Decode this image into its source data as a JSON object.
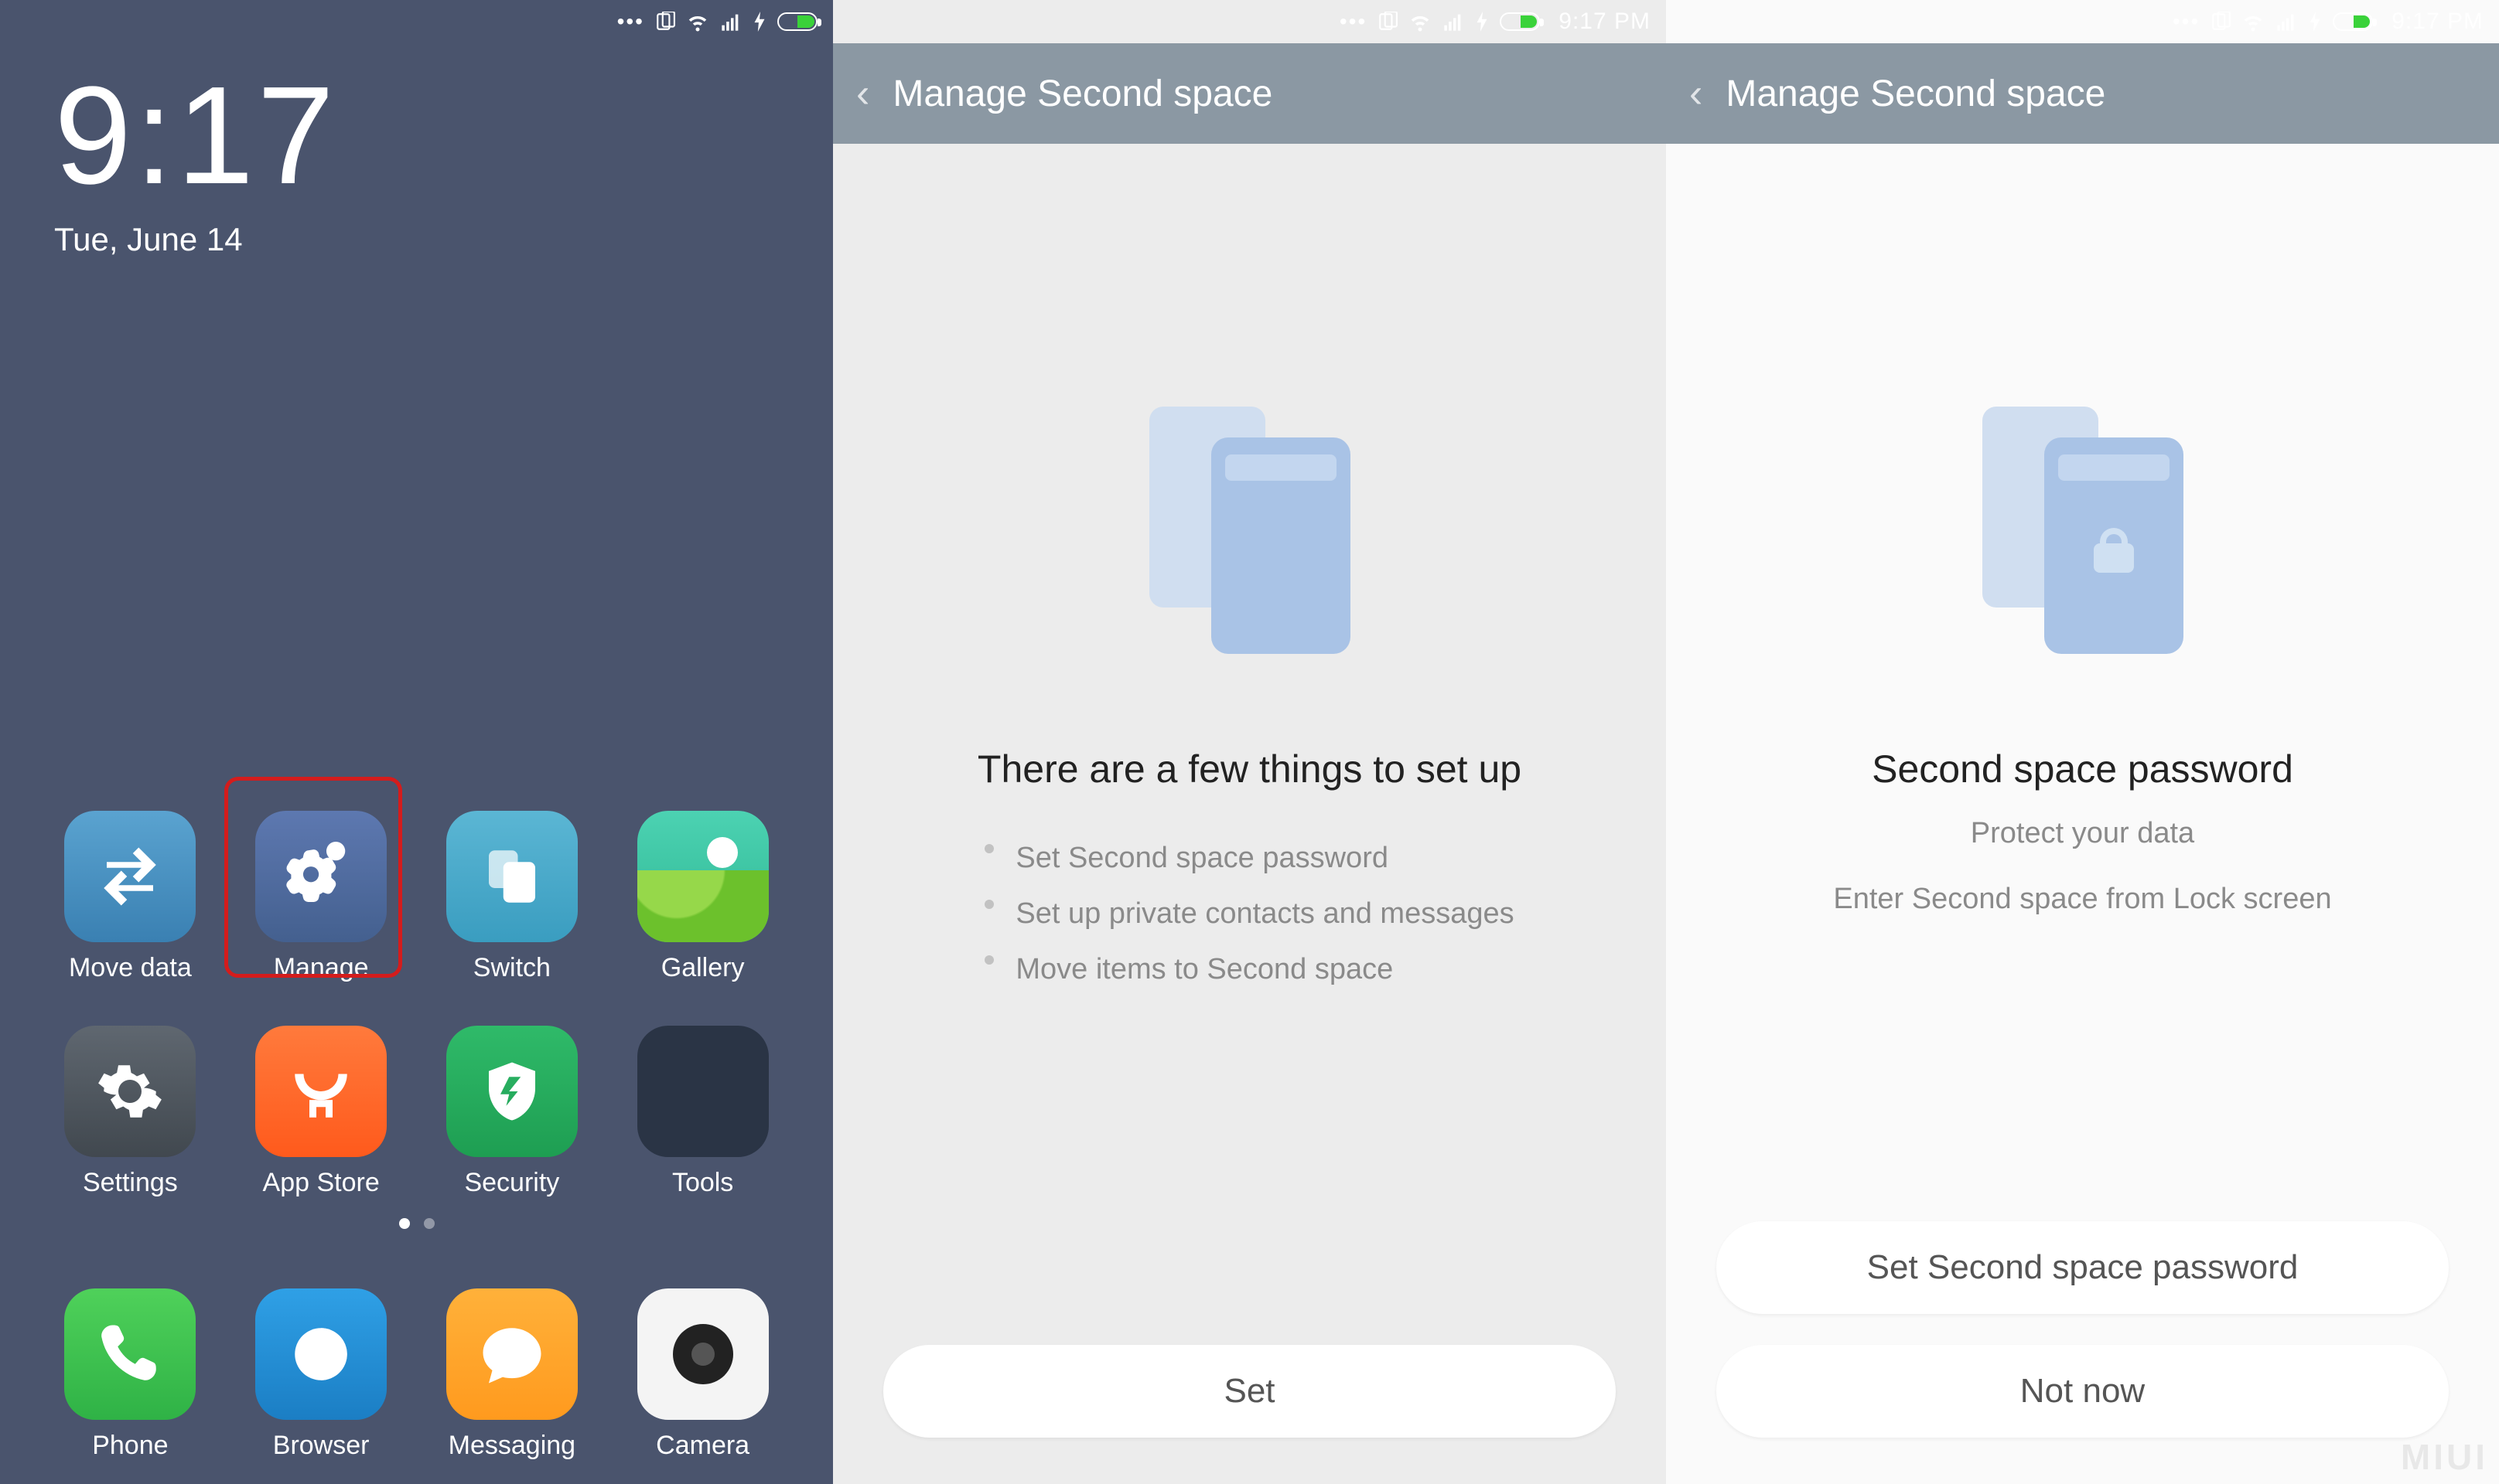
{
  "status": {
    "time": "9:17 PM"
  },
  "home": {
    "clock_time": "9:17",
    "clock_date": "Tue, June 14",
    "apps": {
      "move_data": "Move data",
      "manage": "Manage",
      "switch": "Switch",
      "gallery": "Gallery",
      "settings": "Settings",
      "app_store": "App Store",
      "security": "Security",
      "tools": "Tools"
    },
    "highlighted_app": "Manage",
    "dock": {
      "phone": "Phone",
      "browser": "Browser",
      "messaging": "Messaging",
      "camera": "Camera"
    }
  },
  "screen2": {
    "title": "Manage Second space",
    "heading": "There are a few things to set up",
    "bullets": [
      "Set Second space password",
      "Set up private contacts and messages",
      "Move items to Second space"
    ],
    "primary_button": "Set"
  },
  "screen3": {
    "title": "Manage Second space",
    "heading": "Second space password",
    "sub1": "Protect your data",
    "sub2": "Enter Second space from Lock screen",
    "primary_button": "Set Second space password",
    "secondary_button": "Not now"
  },
  "watermark": "MIUI"
}
